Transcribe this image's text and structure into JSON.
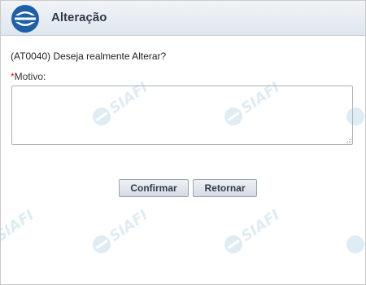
{
  "header": {
    "title": "Alteração",
    "logo_icon": "siafi-logo-icon"
  },
  "form": {
    "question": "(AT0040) Deseja realmente Alterar?",
    "required_marker": "*",
    "motivo_label": "Motivo:",
    "motivo_value": "",
    "motivo_placeholder": ""
  },
  "buttons": {
    "confirm_label": "Confirmar",
    "return_label": "Retornar"
  },
  "watermark": {
    "text": "SIAFI"
  },
  "colors": {
    "required": "#d21c1c",
    "header_title": "#2f3a48",
    "logo_blue": "#1f5fa6",
    "watermark": "#b9d6e6"
  }
}
